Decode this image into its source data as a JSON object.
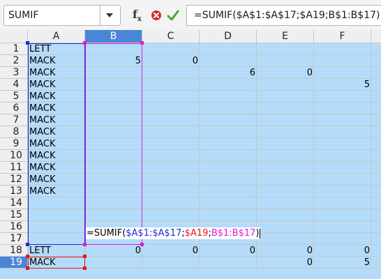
{
  "formula_bar": {
    "name_box": "SUMIF",
    "fx_label": "f",
    "fx_sub": "x",
    "formula": "=SUMIF($A$1:$A$17;$A19;B$1:B$17)"
  },
  "columns": [
    "A",
    "B",
    "C",
    "D",
    "E",
    "F"
  ],
  "selected_column": "B",
  "rows": [
    "1",
    "2",
    "3",
    "4",
    "5",
    "6",
    "7",
    "8",
    "9",
    "10",
    "11",
    "12",
    "13",
    "14",
    "15",
    "16",
    "17",
    "18",
    "19"
  ],
  "selected_row": "19",
  "cells": {
    "A1": "LETT",
    "A2": "MACK",
    "A3": "MACK",
    "A4": "MACK",
    "A5": "MACK",
    "A6": "MACK",
    "A7": "MACK",
    "A8": "MACK",
    "A9": "MACK",
    "A10": "MACK",
    "A11": "MACK",
    "A12": "MACK",
    "A13": "MACK",
    "B2": "5",
    "C2": "0",
    "D3": "6",
    "E3": "0",
    "F4": "5",
    "A18": "LETT",
    "B18": "0",
    "C18": "0",
    "D18": "0",
    "E18": "0",
    "F18": "0",
    "A19": "MACK",
    "E19": "0",
    "F19": "5"
  },
  "edit_formula": {
    "prefix": "=SUMIF(",
    "ref1": "$A$1:$A$17",
    "sep1": ";",
    "ref2": "$A19",
    "sep2": ";",
    "ref3": "B$1:B$17",
    "suffix": ")"
  },
  "ref_colors": {
    "ref1": "#1f2bd6",
    "ref2": "#e0191b",
    "ref3": "#e01cd8"
  },
  "colors": {
    "grid_bg": "#b4dcfa",
    "header_selected": "#4a86d8"
  }
}
